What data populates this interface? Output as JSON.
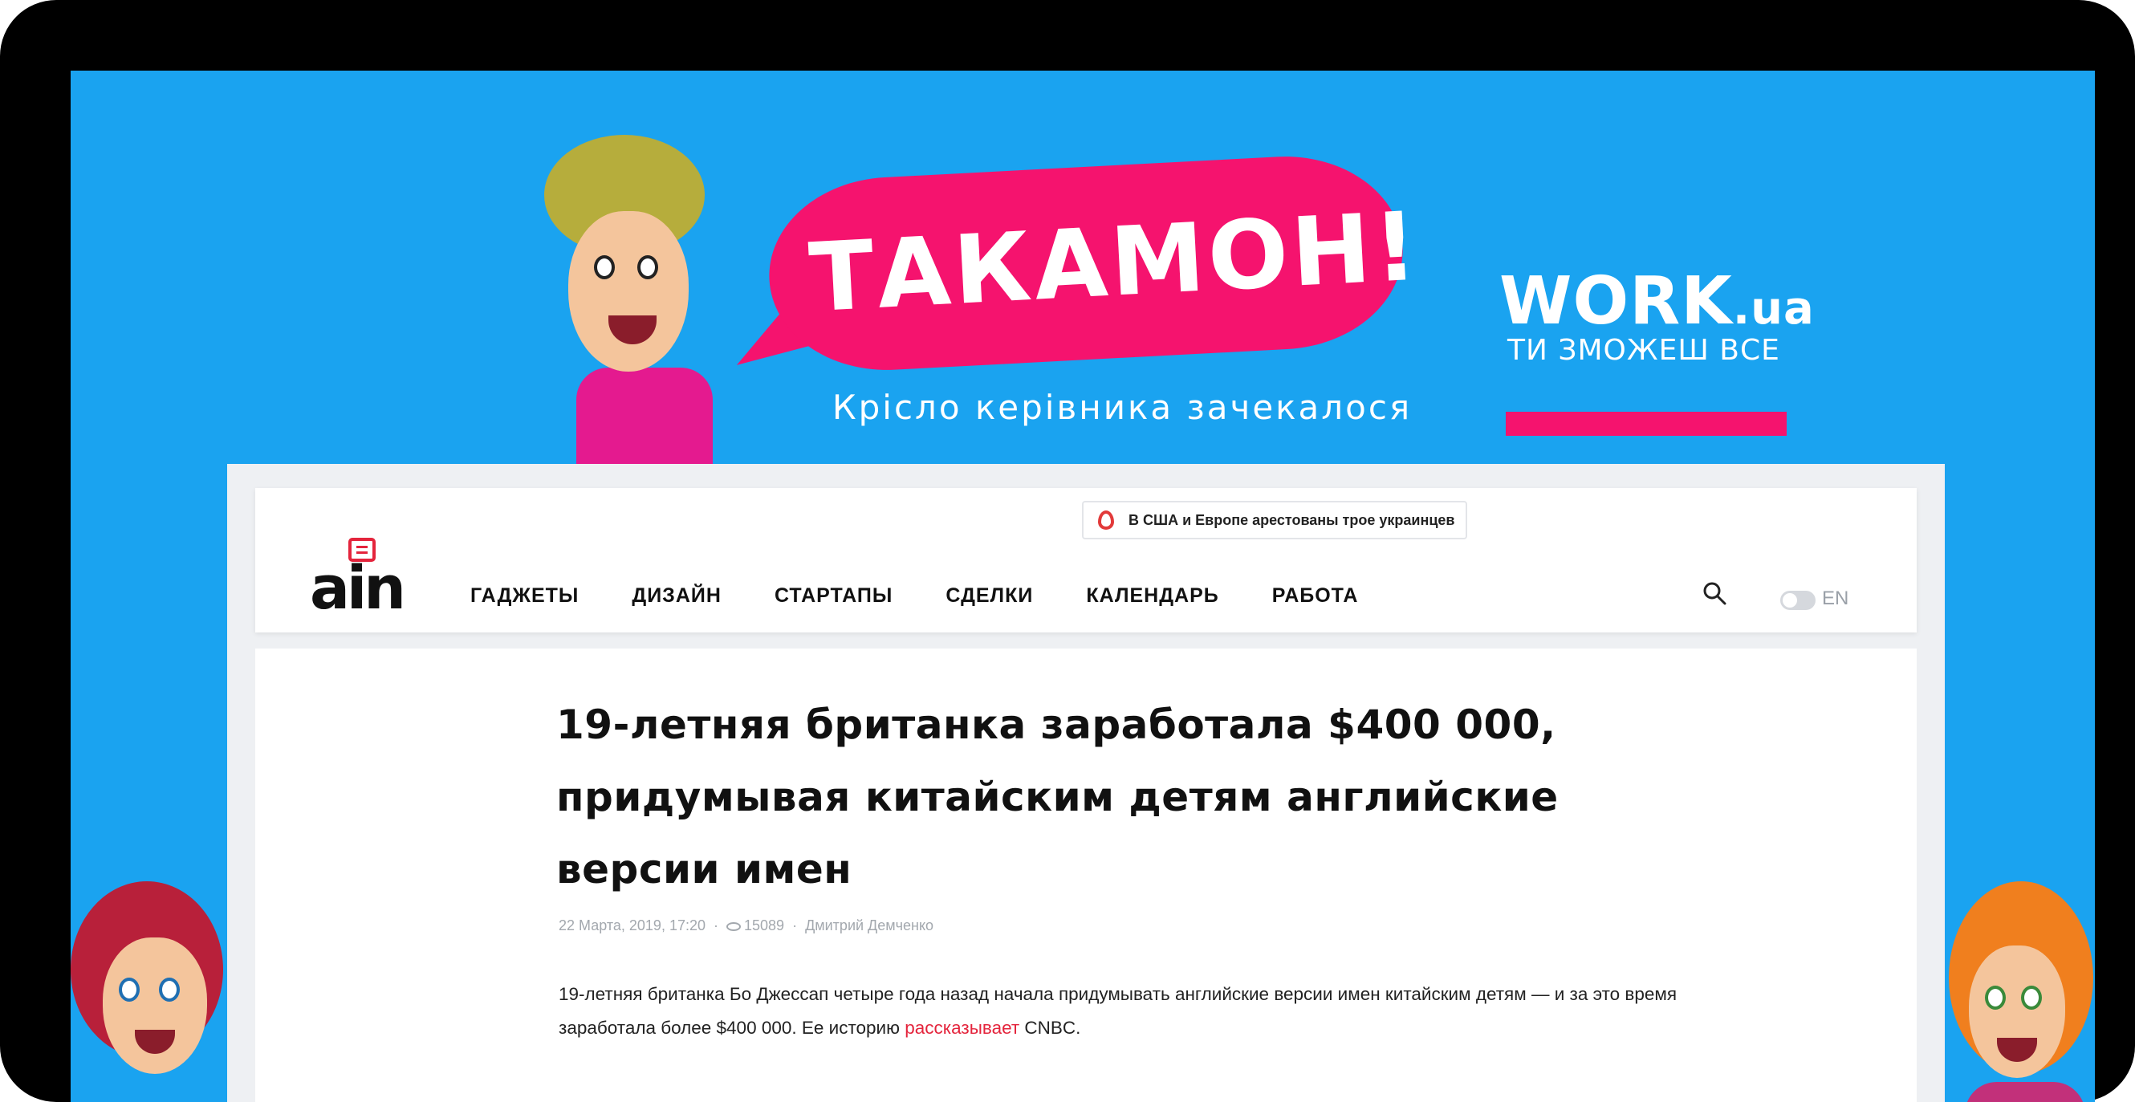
{
  "banner": {
    "slogan": "ТАКАМОН!",
    "subtitle": "Крісло керівника зачекалося",
    "brand_name": "WORK",
    "brand_domain": ".ua",
    "brand_tagline": "ТИ ЗМОЖЕШ ВСЕ",
    "accent_color": "#f5136e",
    "background_color": "#1aa3f0"
  },
  "site": {
    "logo": "ain",
    "breaking_news": "В США и Европе арестованы трое украинцев",
    "nav": [
      "ГАДЖЕТЫ",
      "ДИЗАЙН",
      "СТАРТАПЫ",
      "СДЕЛКИ",
      "КАЛЕНДАРЬ",
      "РАБОТА"
    ],
    "language": "EN",
    "search_icon": "search-icon"
  },
  "article": {
    "title": "19-летняя британка заработала $400 000, придумывая китайским детям английские версии имен",
    "date": "22 Марта, 2019, 17:20",
    "views": "15089",
    "author": "Дмитрий Демченко",
    "lead_before_link": "19-летняя британка Бо Джессап четыре года назад начала придумывать английские версии имен китайским детям — и за это время заработала более $400 000. Ее историю ",
    "lead_link": "рассказывает",
    "lead_after_link": " CNBC."
  }
}
